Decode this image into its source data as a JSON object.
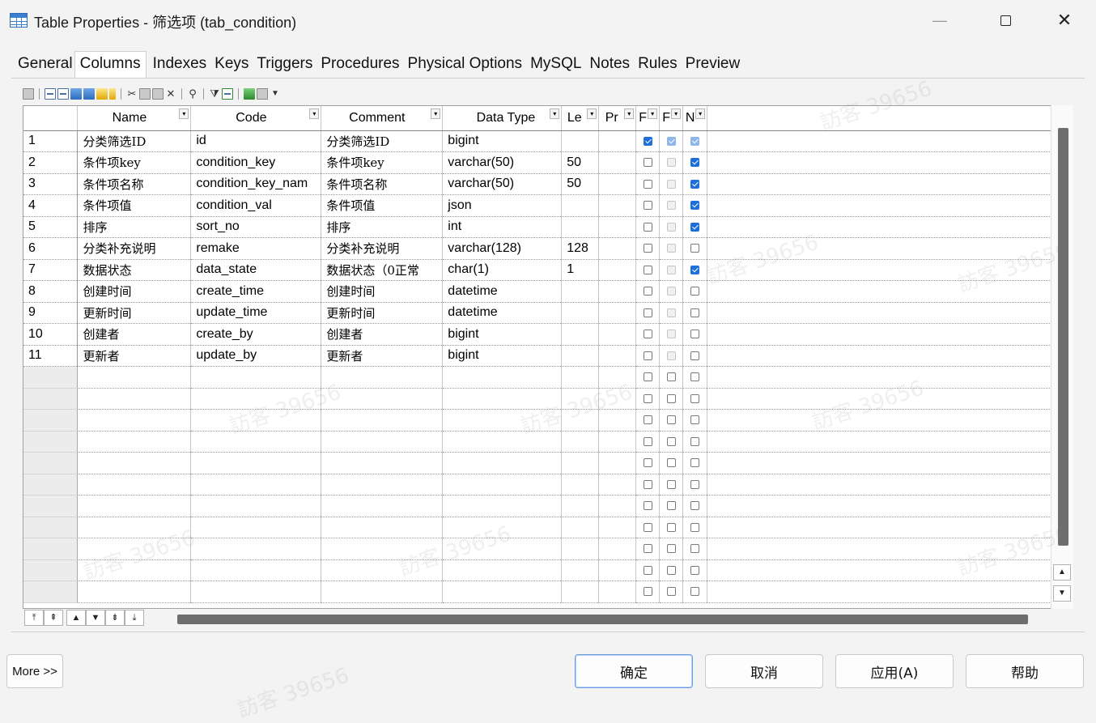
{
  "window": {
    "title": "Table Properties - 筛选项 (tab_condition)",
    "minimize_glyph": "—",
    "close_glyph": "✕"
  },
  "tabs": [
    "General",
    "Columns",
    "Indexes",
    "Keys",
    "Triggers",
    "Procedures",
    "Physical Options",
    "MySQL",
    "Notes",
    "Rules",
    "Preview"
  ],
  "active_tab": "Columns",
  "toolbar": {
    "icons": [
      "properties-icon",
      "insert-row-icon",
      "add-row-icon",
      "add-columns-icon",
      "reuse-columns-icon",
      "new-domain-icon",
      "tooltip-icon",
      "cut-icon",
      "copy-icon",
      "paste-icon",
      "delete-icon",
      "find-icon",
      "filter-icon",
      "customize-columns-icon",
      "excel-export-icon",
      "print-icon",
      "dropdown-arrow-icon"
    ],
    "dropdown_glyph": "▼"
  },
  "grid": {
    "headers": [
      "Name",
      "Code",
      "Comment",
      "Data Type",
      "Le",
      "Pr",
      "F",
      "F",
      "N"
    ],
    "header_dropdown_glyph": "▾",
    "rows": [
      {
        "num": "1",
        "name": "分类筛选ID",
        "code": "id",
        "comment": "分类筛选ID",
        "type": "bigint",
        "len": "",
        "prec": "",
        "p": true,
        "f": true,
        "m": true
      },
      {
        "num": "2",
        "name": "条件项key",
        "code": "condition_key",
        "comment": "条件项key",
        "type": "varchar(50)",
        "len": "50",
        "prec": "",
        "p": false,
        "f": false,
        "m": true
      },
      {
        "num": "3",
        "name": "条件项名称",
        "code": "condition_key_nam",
        "comment": "条件项名称",
        "type": "varchar(50)",
        "len": "50",
        "prec": "",
        "p": false,
        "f": false,
        "m": true
      },
      {
        "num": "4",
        "name": "条件项值",
        "code": "condition_val",
        "comment": "条件项值",
        "type": "json",
        "len": "",
        "prec": "",
        "p": false,
        "f": false,
        "m": true
      },
      {
        "num": "5",
        "name": "排序",
        "code": "sort_no",
        "comment": "排序",
        "type": "int",
        "len": "",
        "prec": "",
        "p": false,
        "f": false,
        "m": true
      },
      {
        "num": "6",
        "name": "分类补充说明",
        "code": "remake",
        "comment": "分类补充说明",
        "type": "varchar(128)",
        "len": "128",
        "prec": "",
        "p": false,
        "f": false,
        "m": false
      },
      {
        "num": "7",
        "name": "数据状态",
        "code": "data_state",
        "comment": "数据状态（0正常",
        "type": "char(1)",
        "len": "1",
        "prec": "",
        "p": false,
        "f": false,
        "m": true
      },
      {
        "num": "8",
        "name": "创建时间",
        "code": "create_time",
        "comment": "创建时间",
        "type": "datetime",
        "len": "",
        "prec": "",
        "p": false,
        "f": false,
        "m": false
      },
      {
        "num": "9",
        "name": "更新时间",
        "code": "update_time",
        "comment": "更新时间",
        "type": "datetime",
        "len": "",
        "prec": "",
        "p": false,
        "f": false,
        "m": false
      },
      {
        "num": "10",
        "name": "创建者",
        "code": "create_by",
        "comment": "创建者",
        "type": "bigint",
        "len": "",
        "prec": "",
        "p": false,
        "f": false,
        "m": false
      },
      {
        "num": "11",
        "name": "更新者",
        "code": "update_by",
        "comment": "更新者",
        "type": "bigint",
        "len": "",
        "prec": "",
        "p": false,
        "f": false,
        "m": false
      }
    ],
    "empty_rows": 11
  },
  "scroll": {
    "up_glyph": "▲",
    "down_glyph": "▼"
  },
  "nav_buttons": [
    "⤒",
    "⇞",
    "▲",
    "▼",
    "⇟",
    "⤓"
  ],
  "buttons": {
    "more": "More >>",
    "ok": "确定",
    "cancel": "取消",
    "apply": "应用(A)",
    "help": "帮助"
  },
  "watermark_text": "訪客 39656",
  "colors": {
    "checkbox_on": "#1e6fd9",
    "scrollbar_thumb": "#6e6e6e",
    "app_icon": "#3c7fd0"
  }
}
